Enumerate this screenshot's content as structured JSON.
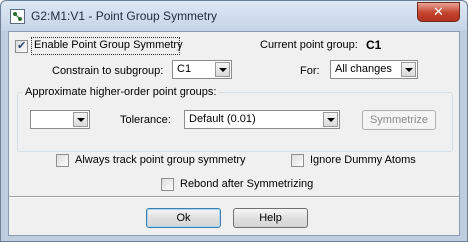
{
  "window": {
    "title": "G2:M1:V1 - Point Group Symmetry",
    "close_glyph": "✕",
    "icon": "app-icon"
  },
  "enable": {
    "label": "Enable Point Group Symmetry",
    "checked": true
  },
  "current_point_group": {
    "label": "Current point group:",
    "value": "C1"
  },
  "constrain": {
    "label": "Constrain to subgroup:",
    "value": "C1"
  },
  "for": {
    "label": "For:",
    "value": "All changes"
  },
  "approx": {
    "group_label": "Approximate higher-order point groups:",
    "combo_value": "",
    "tolerance_label": "Tolerance:",
    "tolerance_value": "Default (0.01)",
    "symmetrize_label": "Symmetrize"
  },
  "options": {
    "always_track": {
      "label": "Always track point group symmetry",
      "checked": false
    },
    "ignore_dummy": {
      "label": "Ignore Dummy Atoms",
      "checked": false
    },
    "rebond": {
      "label": "Rebond after Symmetrizing",
      "checked": false
    }
  },
  "buttons": {
    "ok": "Ok",
    "help": "Help"
  }
}
